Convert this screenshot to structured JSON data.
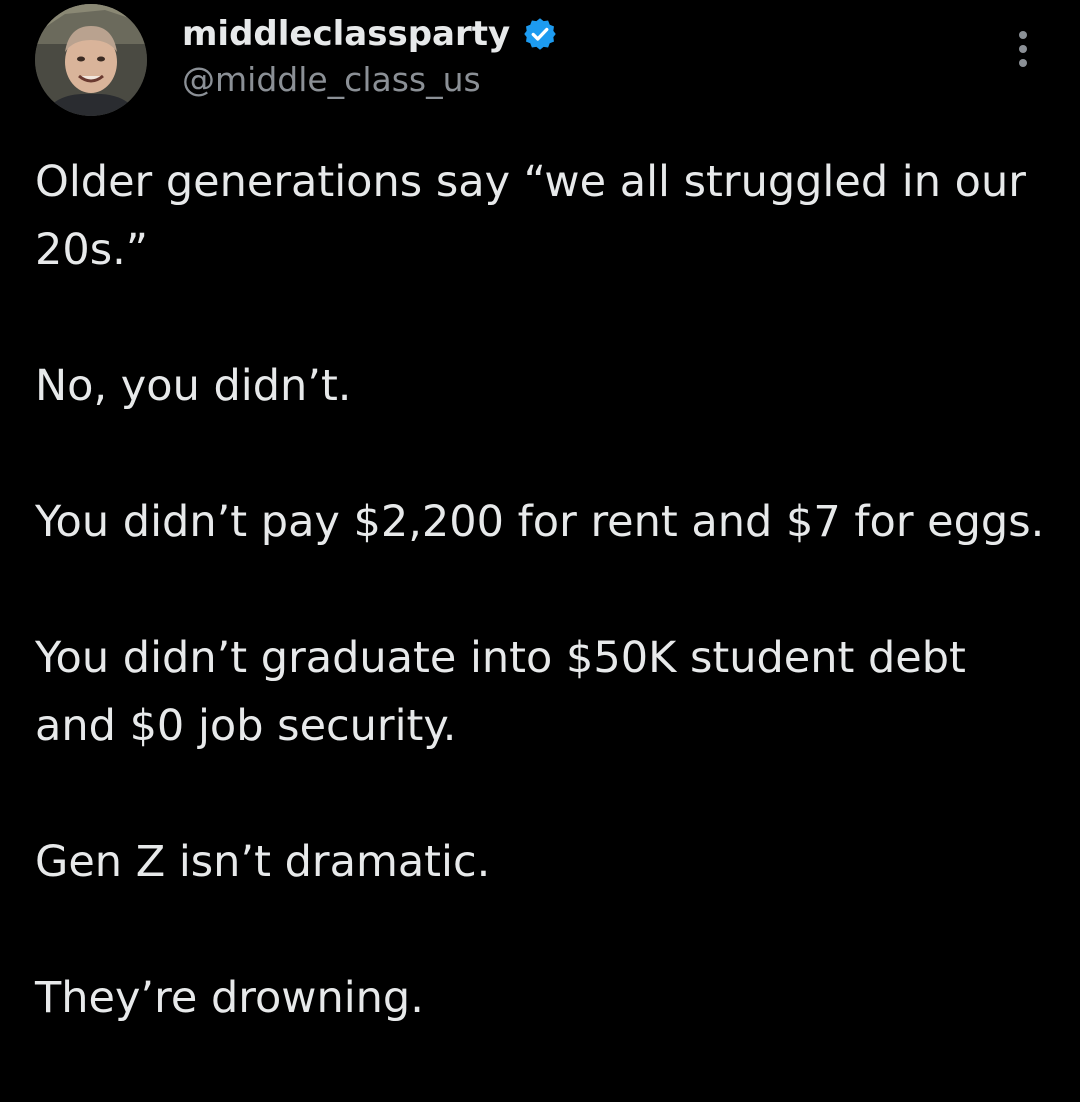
{
  "author": {
    "display_name": "middleclassparty",
    "handle": "@middle_class_us",
    "verified": true,
    "verified_color": "#1d9bf0"
  },
  "icons": {
    "verified": "verified-badge-icon",
    "more": "more-vertical-icon"
  },
  "tweet": {
    "paragraphs": [
      "Older generations say “we all struggled in our 20s.”",
      "No, you didn’t.",
      "You didn’t pay $2,200 for rent and $7 for eggs.",
      "You didn’t graduate into $50K student debt and $0 job security.",
      "Gen Z isn’t dramatic.",
      "They’re drowning."
    ]
  },
  "colors": {
    "background": "#000000",
    "text_primary": "#e7e9ea",
    "text_secondary": "#8b9096"
  }
}
